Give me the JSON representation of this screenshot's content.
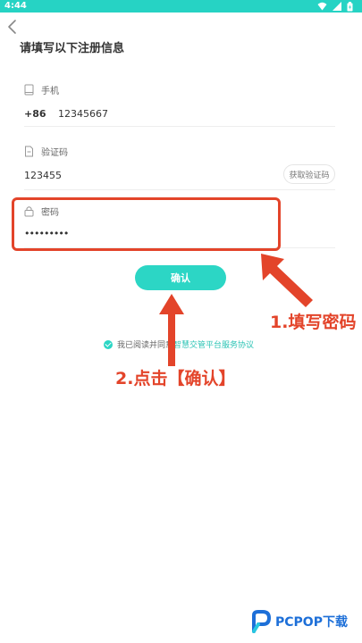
{
  "status_bar": {
    "time": "4:44"
  },
  "header": {
    "title": "请填写以下注册信息"
  },
  "form": {
    "phone": {
      "label": "手机",
      "prefix": "+86",
      "value": "12345667"
    },
    "code": {
      "label": "验证码",
      "value": "123455",
      "button": "获取验证码"
    },
    "password": {
      "label": "密码",
      "value": "•••••••••"
    }
  },
  "confirm_button": "确认",
  "agreement": {
    "text": "我已阅读并同意",
    "link": "智慧交管平台服务协议"
  },
  "annotations": {
    "step1": "1.填写密码",
    "step2": "2.点击【确认】"
  },
  "watermark": {
    "brand": "PCPOP下载"
  },
  "colors": {
    "accent": "#2cd6c5",
    "annotation": "#e3442a",
    "status_bar": "#26d3c4"
  }
}
